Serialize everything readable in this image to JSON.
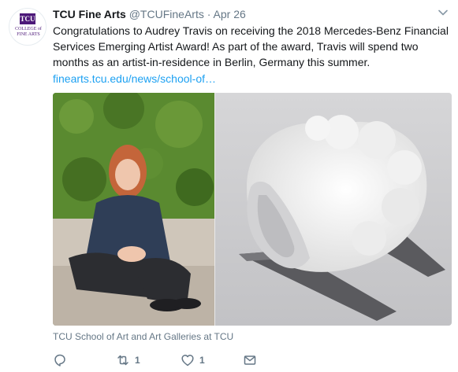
{
  "tweet": {
    "avatar_logo": "TCU",
    "avatar_caption": "COLLEGE of FINE ARTS",
    "display_name": "TCU Fine Arts",
    "handle": "@TCUFineArts",
    "separator": "·",
    "date": "Apr 26",
    "text": "Congratulations to Audrey Travis on receiving the 2018 Mercedes-Benz Financial Services Emerging Artist Award! As part of the award, Travis will spend two months as an artist-in-residence in Berlin, Germany this summer.",
    "link_text": "finearts.tcu.edu/news/school-of…",
    "media_caption": "TCU School of Art and Art Galleries at TCU"
  },
  "actions": {
    "reply_icon": "reply-icon",
    "retweet_icon": "retweet-icon",
    "retweet_count": "1",
    "like_icon": "heart-icon",
    "like_count": "1",
    "message_icon": "envelope-icon"
  },
  "colors": {
    "link": "#1da1f2",
    "muted": "#657786",
    "brand_purple": "#4d1979"
  }
}
